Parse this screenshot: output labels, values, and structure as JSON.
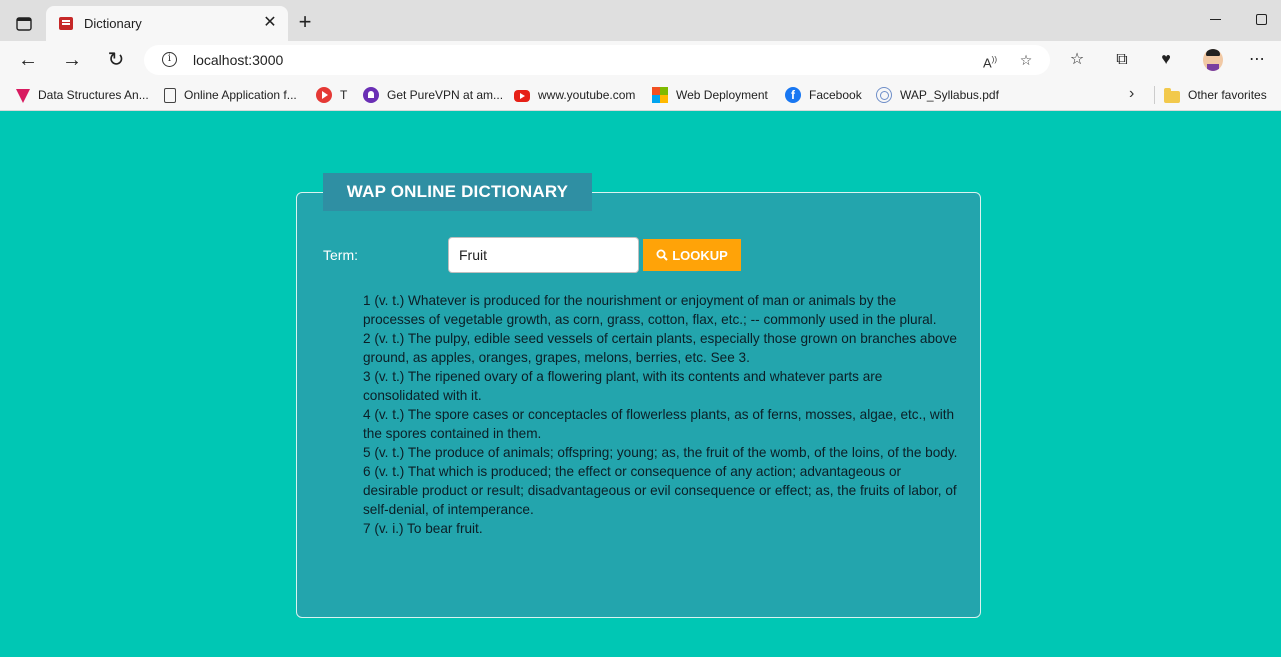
{
  "browser": {
    "tab_title": "Dictionary",
    "url": "localhost:3000",
    "favorites": [
      {
        "label": "Data Structures An...",
        "icon": "ds-icon"
      },
      {
        "label": "Online Application f...",
        "icon": "page-icon"
      },
      {
        "label": "T",
        "icon": "youtube-circle-icon"
      },
      {
        "label": "Get PureVPN at am...",
        "icon": "purevpn-icon"
      },
      {
        "label": "www.youtube.com",
        "icon": "youtube-icon"
      },
      {
        "label": "Web Deployment",
        "icon": "microsoft-icon"
      },
      {
        "label": "Facebook",
        "icon": "facebook-icon"
      },
      {
        "label": "WAP_Syllabus.pdf",
        "icon": "wap-icon"
      }
    ],
    "other_favorites": "Other favorites"
  },
  "app": {
    "legend": "WAP ONLINE DICTIONARY",
    "term_label": "Term:",
    "term_value": "Fruit",
    "lookup_label": "LOOKUP",
    "definitions": [
      "1 (v. t.) Whatever is produced for the nourishment or enjoyment of man or animals by the processes of vegetable growth, as corn, grass, cotton, flax, etc.; -- commonly used in the plural.",
      "2 (v. t.) The pulpy, edible seed vessels of certain plants, especially those grown on branches above ground, as apples, oranges, grapes, melons, berries, etc. See 3.",
      "3 (v. t.) The ripened ovary of a flowering plant, with its contents and whatever parts are consolidated with it.",
      "4 (v. t.) The spore cases or conceptacles of flowerless plants, as of ferns, mosses, algae, etc., with the spores contained in them.",
      "5 (v. t.) The produce of animals; offspring; young; as, the fruit of the womb, of the loins, of the body.",
      "6 (v. t.) That which is produced; the effect or consequence of any action; advantageous or desirable product or result; disadvantageous or evil consequence or effect; as, the fruits of labor, of self-denial, of intemperance.",
      "7 (v. i.) To bear fruit."
    ]
  },
  "colors": {
    "page_background": "#00c7b4",
    "fieldset_background": "#23a5ad",
    "legend_background": "#2f8fa3",
    "button_background": "#ffa308"
  }
}
